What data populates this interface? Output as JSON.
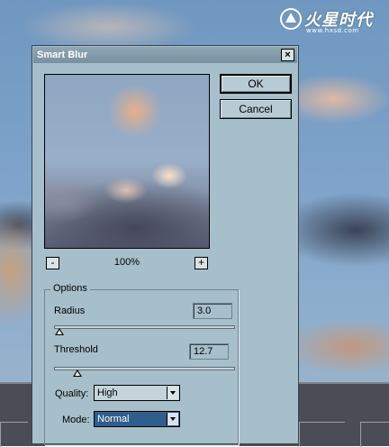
{
  "dialog": {
    "title": "Smart Blur",
    "close_glyph": "×",
    "ok_label": "OK",
    "cancel_label": "Cancel"
  },
  "preview": {
    "zoom": "100%",
    "zoom_out": "-",
    "zoom_in": "+"
  },
  "options": {
    "legend": "Options",
    "radius_label": "Radius",
    "radius_value": "3.0",
    "radius_fraction": 0.03,
    "threshold_label": "Threshold",
    "threshold_value": "12.7",
    "threshold_fraction": 0.127,
    "quality_label": "Quality:",
    "quality_value": "High",
    "mode_label": "Mode:",
    "mode_value": "Normal"
  },
  "watermark": {
    "name": "火星时代",
    "url": "www.hxsd.com",
    "icon": "hxsd-logo-icon"
  }
}
